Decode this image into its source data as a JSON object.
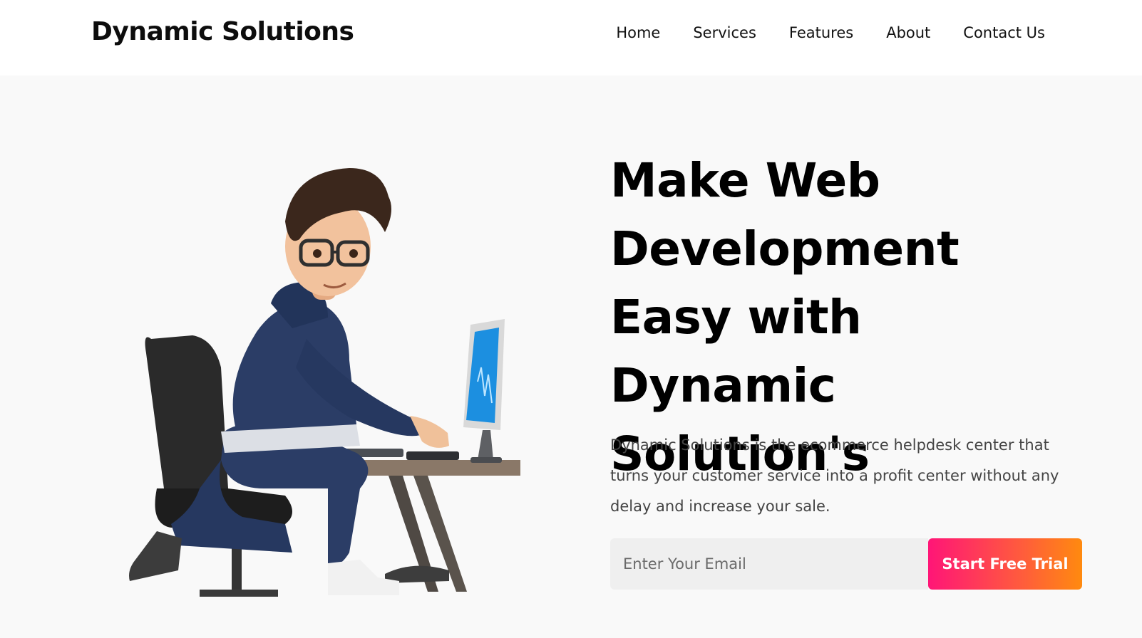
{
  "header": {
    "brand": "Dynamic Solutions",
    "nav": [
      "Home",
      "Services",
      "Features",
      "About",
      "Contact Us"
    ]
  },
  "hero": {
    "headline": "Make Web Development Easy with Dynamic Solution's",
    "description": "Dynamic Solutions is the ecommerce helpdesk center that turns your customer service into a profit center without any delay and increase your sale.",
    "email_placeholder": "Enter Your Email",
    "cta_label": "Start Free Trial",
    "illustration": "developer-at-computer-illustration"
  },
  "colors": {
    "cta_gradient_start": "#ff1577",
    "cta_gradient_end": "#ff8a0f",
    "hero_bg": "#f9f9f9",
    "hoodie": "#2b3d66",
    "monitor_screen": "#1c8fe0"
  }
}
